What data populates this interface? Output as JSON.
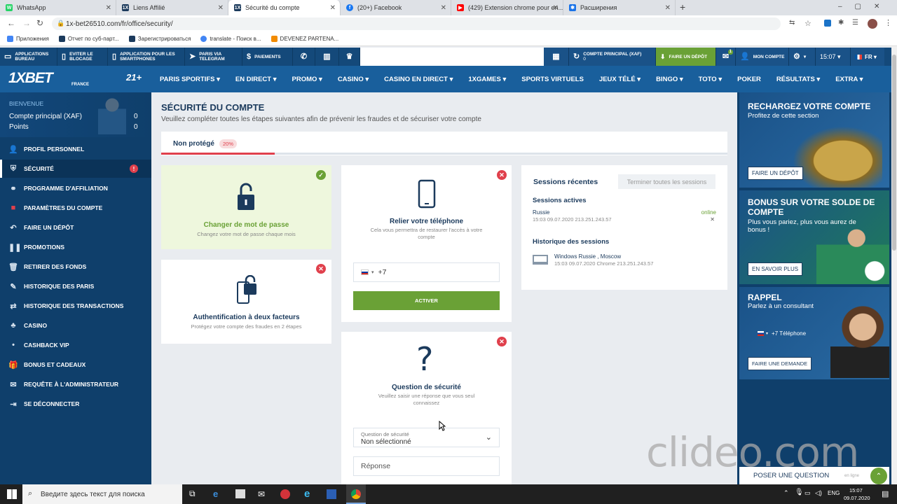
{
  "browser": {
    "tabs": [
      {
        "label": "WhatsApp",
        "color": "#25d366",
        "glyph": "W"
      },
      {
        "label": "Liens Affilié",
        "color": "#1b3a5c",
        "glyph": "1X"
      },
      {
        "label": "Sécurité du compte",
        "color": "#1b3a5c",
        "glyph": "1X"
      },
      {
        "label": "(20+) Facebook",
        "color": "#1877f2",
        "glyph": "f"
      },
      {
        "label": "(429) Extension chrome pour en...",
        "color": "#ff0000",
        "glyph": "▶"
      },
      {
        "label": "Расширения",
        "color": "#1a73e8",
        "glyph": "✱"
      }
    ],
    "new_tab": "+",
    "url": "1x-bet26510.com/fr/office/security/",
    "bookmarks": [
      {
        "label": "Приложения",
        "color": "#4285f4"
      },
      {
        "label": "Отчет по суб-парт...",
        "color": "#1b3a5c"
      },
      {
        "label": "Зарегистрироваться",
        "color": "#1b3a5c"
      },
      {
        "label": "translate - Поиск в...",
        "color": "#4285f4"
      },
      {
        "label": "DEVENEZ PARTENA...",
        "color": "#f28b00"
      }
    ]
  },
  "topbar": {
    "left_items": [
      {
        "label": "APPLICATIONS BUREAU",
        "icon": "▭"
      },
      {
        "label": "EVITER LE BLOCAGE",
        "icon": "▯"
      },
      {
        "label": "APPLICATION POUR LES SMARTPHONES",
        "icon": "▯"
      },
      {
        "label": "PARIS VIA TELEGRAM",
        "icon": "➤"
      },
      {
        "label": "PAIEMENTS",
        "icon": "$"
      },
      {
        "label": "",
        "icon": "✆"
      },
      {
        "label": "",
        "icon": "▥"
      },
      {
        "label": "",
        "icon": "♛"
      }
    ],
    "account_label": "COMPTE PRINCIPAL (XAF)",
    "account_value": "0",
    "deposit_label": "FAIRE UN DÉPÔT",
    "mail_badge": "1",
    "my_account": "MON COMPTE",
    "time": "15:07",
    "lang": "FR"
  },
  "nav": {
    "logo": "1XBET",
    "logo_sub": "FRANCE",
    "age": "21+",
    "items": [
      "PARIS SPORTIFS ▾",
      "EN DIRECT ▾",
      "PROMO ▾",
      "CASINO ▾",
      "CASINO EN DIRECT ▾",
      "1XGAMES ▾",
      "SPORTS VIRTUELS",
      "JEUX TÉLÉ ▾",
      "BINGO ▾",
      "TOTO ▾",
      "POKER",
      "RÉSULTATS ▾",
      "EXTRA ▾"
    ]
  },
  "sidebar": {
    "welcome": "BIENVENUE",
    "account_label": "Compte principal (XAF)",
    "account_value": "0",
    "points_label": "Points",
    "points_value": "0",
    "items": [
      {
        "label": "PROFIL PERSONNEL",
        "icon": "👤"
      },
      {
        "label": "SÉCURITÉ",
        "icon": "⛨"
      },
      {
        "label": "PROGRAMME D'AFFILIATION",
        "icon": "⚭"
      },
      {
        "label": "PARAMÈTRES DU COMPTE",
        "icon": "■"
      },
      {
        "label": "FAIRE UN DÉPÔT",
        "icon": "↶"
      },
      {
        "label": "PROMOTIONS",
        "icon": "❚❚"
      },
      {
        "label": "RETIRER DES FONDS",
        "icon": "🗑"
      },
      {
        "label": "HISTORIQUE DES PARIS",
        "icon": "✎"
      },
      {
        "label": "HISTORIQUE DES TRANSACTIONS",
        "icon": "⇄"
      },
      {
        "label": "CASINO",
        "icon": "♣"
      },
      {
        "label": "CASHBACK VIP",
        "icon": "•"
      },
      {
        "label": "BONUS ET CADEAUX",
        "icon": "🎁"
      },
      {
        "label": "REQUÊTE À L'ADMINISTRATEUR",
        "icon": "✉"
      },
      {
        "label": "SE DÉCONNECTER",
        "icon": "⇥"
      }
    ],
    "security_badge": "!"
  },
  "main": {
    "title": "SÉCURITÉ DU COMPTE",
    "subtitle": "Veuillez compléter toutes les étapes suivantes afin de prévenir les fraudes et de sécuriser votre compte",
    "status_label": "Non protégé",
    "status_percent": "20%",
    "progress": 0.2,
    "password_card": {
      "title": "Changer de mot de passe",
      "subtitle": "Changez votre mot de passe chaque mois"
    },
    "twofa_card": {
      "title": "Authentification à deux facteurs",
      "subtitle": "Protégez votre compte des fraudes en 2 étapes"
    },
    "phone_card": {
      "title": "Relier votre téléphone",
      "subtitle": "Cela vous permettra de restaurer l'accès à votre compte",
      "prefix": "+7",
      "activate": "ACTIVER"
    },
    "question_card": {
      "title": "Question de sécurité",
      "subtitle": "Veuillez saisir une réponse que vous seul connaissez",
      "select_label": "Question de sécurité",
      "select_value": "Non sélectionné",
      "answer_placeholder": "Réponse"
    },
    "sessions": {
      "title": "Sessions récentes",
      "end_all": "Terminer toutes les sessions",
      "active_title": "Sessions actives",
      "active_country": "Russie",
      "active_details": "15:03 09.07.2020 213.251.243.57",
      "active_status": "online",
      "history_title": "Historique des sessions",
      "history_device": "Windows Russie , Moscow",
      "history_details": "15:03 09.07.2020 Chrome 213.251.243.57"
    }
  },
  "right": {
    "recharge_title": "RECHARGEZ VOTRE COMPTE",
    "recharge_sub": "Profitez de cette section",
    "recharge_btn": "FAIRE UN DÉPÔT",
    "bonus_title": "BONUS SUR VOTRE SOLDE DE COMPTE",
    "bonus_sub": "Plus vous pariez, plus vous aurez de bonus !",
    "bonus_btn": "EN SAVOIR PLUS",
    "recall_title": "RAPPEL",
    "recall_sub": "Parlez à un consultant",
    "recall_phone": "+7 Téléphone",
    "recall_btn": "FAIRE UNE DEMANDE",
    "ask_question": "POSER UNE QUESTION",
    "ask_status": "en ligne"
  },
  "taskbar": {
    "search_placeholder": "Введите здесь текст для поиска",
    "lang": "ENG",
    "time": "15:07",
    "date": "09.07.2020"
  },
  "watermark": "clideo.com"
}
